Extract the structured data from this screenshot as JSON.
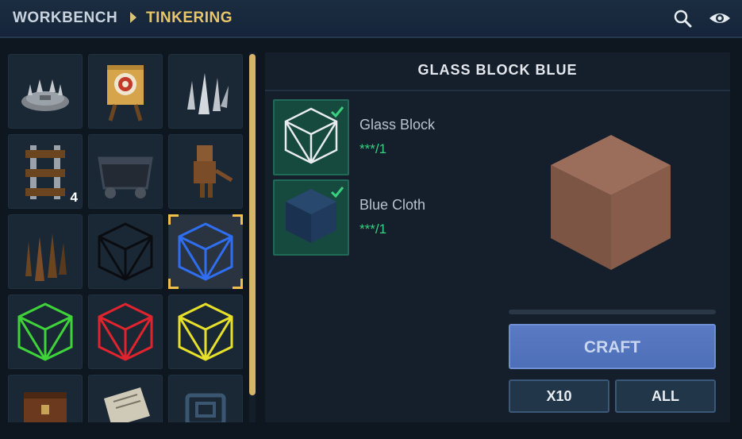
{
  "header": {
    "breadcrumb_root": "WORKBENCH",
    "breadcrumb_current": "TINKERING",
    "icons": [
      "search-icon",
      "eye-icon"
    ]
  },
  "inventory": {
    "items": [
      {
        "icon": "spike-trap-icon"
      },
      {
        "icon": "archery-target-icon"
      },
      {
        "icon": "metal-spikes-icon"
      },
      {
        "icon": "rail-track-icon",
        "count": "4"
      },
      {
        "icon": "minecart-icon"
      },
      {
        "icon": "training-dummy-icon"
      },
      {
        "icon": "wooden-stakes-icon"
      },
      {
        "icon": "glass-block-black-icon"
      },
      {
        "icon": "glass-block-blue-icon",
        "selected": true
      },
      {
        "icon": "glass-block-green-icon"
      },
      {
        "icon": "glass-block-red-icon"
      },
      {
        "icon": "glass-block-yellow-icon"
      },
      {
        "icon": "wooden-chest-icon"
      },
      {
        "icon": "scroll-icon"
      },
      {
        "icon": "metal-plate-icon"
      }
    ]
  },
  "recipe": {
    "title": "GLASS BLOCK BLUE",
    "ingredients": [
      {
        "name": "Glass Block",
        "quantity": "***/1",
        "icon": "glass-block-icon"
      },
      {
        "name": "Blue Cloth",
        "quantity": "***/1",
        "icon": "blue-cloth-icon"
      }
    ],
    "preview_icon": "cube-preview-icon"
  },
  "actions": {
    "craft_label": "CRAFT",
    "x10_label": "X10",
    "all_label": "ALL"
  },
  "colors": {
    "accent_gold": "#e8c66a",
    "check_green": "#39d07f",
    "craft_blue": "#5a7bc4"
  }
}
